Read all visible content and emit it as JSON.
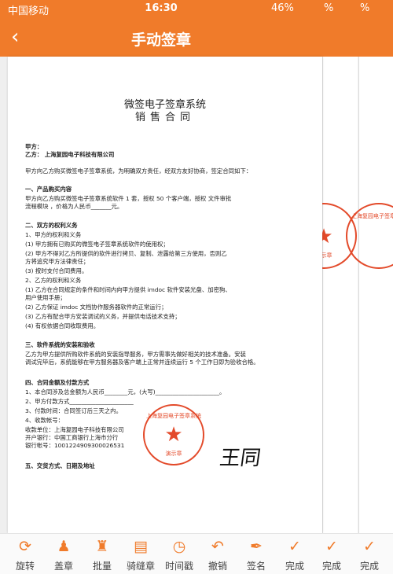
{
  "status": {
    "carrier": "中国移动",
    "time": "16:30",
    "battery": "46%",
    "extra1": "%",
    "extra2": "%"
  },
  "nav": {
    "title": "手动签章"
  },
  "doc": {
    "title": "微签电子签章系统",
    "subtitle": "销售合同",
    "lines": [
      {
        "text": "甲方：",
        "bold": true
      },
      {
        "text": "乙方：   上海复园电子科技有限公司",
        "bold": true
      },
      {
        "text": "     甲方向乙方购买微签电子签章系统，为明确双方责任，经双方友好协商，签定合同如下：",
        "bold": false
      },
      {
        "text": "一、产品购买内容",
        "bold": true
      },
      {
        "text": "     甲方向乙方购买微签电子签章系统软件  1  套，授权  50  个客户端，授权 文件审批",
        "bold": false
      },
      {
        "text": "     流程模块    ，价格为人民币_______元。",
        "bold": false
      },
      {
        "text": "二、双方的权利义务",
        "bold": true
      },
      {
        "text": "     1、甲方的权利和义务",
        "bold": false
      },
      {
        "text": "        (1)    甲方拥有已购买的微签电子签章系统软件的使用权；",
        "bold": false
      },
      {
        "text": "        (2)    甲方不得对乙方所提供的软件进行拷贝、复制、泄露给第三方使用，否则乙",
        "bold": false
      },
      {
        "text": "               方将追究甲方法律责任；",
        "bold": false
      },
      {
        "text": "        (3)    按时支付合同费用。",
        "bold": false
      },
      {
        "text": "     2、乙方的权利和义务",
        "bold": false
      },
      {
        "text": "        (1)    乙方在合同规定的条件和时间内向甲方提供 imdoc 软件安装光盘、加密狗、",
        "bold": false
      },
      {
        "text": "               用户使用手册；",
        "bold": false
      },
      {
        "text": "        (2)    乙方保证 imdoc 文档协作服务器软件的正常运行；",
        "bold": false
      },
      {
        "text": "        (3)    乙方有配合甲方安装调试的义务，并提供电话技术支持；",
        "bold": false
      },
      {
        "text": "        (4)    有权依据合同收取费用。",
        "bold": false
      },
      {
        "text": "三、软件系统的安装和验收",
        "bold": true
      },
      {
        "text": "     乙方为甲方提供所购软件系统的安装指导服务，甲方需事先做好相关的技术准备。安装",
        "bold": false
      },
      {
        "text": "     调试完毕后，系统能够在甲方服务器及客户端上正常并连续运行 5 个工作日即为验收合格。",
        "bold": false
      },
      {
        "text": "四、合同金额及付款方式",
        "bold": true
      },
      {
        "text": "     1、本合同涉及总金额为人民币________元，(大写)______________________。",
        "bold": false
      },
      {
        "text": "     2、甲方付款方式______________________",
        "bold": false
      },
      {
        "text": "     3、付款时间：合同签订后三天之内。",
        "bold": false
      },
      {
        "text": "     4、收款帐号：",
        "bold": false
      },
      {
        "text": "        收款单位：上海复园电子科技有限公司",
        "bold": false
      },
      {
        "text": "        开户银行：中国工商银行上海市分行",
        "bold": false
      },
      {
        "text": "        银行帐号：1001224909300026531",
        "bold": false
      },
      {
        "text": "五、交货方式、日期及地址",
        "bold": true
      }
    ],
    "seal_text": "上海复园电子签章系统",
    "seal_sub": "演示章",
    "signature": "王同"
  },
  "toolbar": [
    {
      "label": "旋转",
      "icon": "rotate-icon",
      "glyph": "⟳"
    },
    {
      "label": "盖章",
      "icon": "stamp-icon",
      "glyph": "♟"
    },
    {
      "label": "批量",
      "icon": "batch-icon",
      "glyph": "♜"
    },
    {
      "label": "骑缝章",
      "icon": "seam-stamp-icon",
      "glyph": "▤"
    },
    {
      "label": "时间戳",
      "icon": "timestamp-icon",
      "glyph": "◷"
    },
    {
      "label": "撤销",
      "icon": "undo-icon",
      "glyph": "↶"
    },
    {
      "label": "签名",
      "icon": "pen-icon",
      "glyph": "✒"
    },
    {
      "label": "完成",
      "icon": "check-icon",
      "glyph": "✓"
    },
    {
      "label": "完成",
      "icon": "check-icon",
      "glyph": "✓"
    },
    {
      "label": "完成",
      "icon": "check-icon",
      "glyph": "✓"
    }
  ],
  "colors": {
    "accent": "#f07b2a",
    "seal": "#e34a2a"
  }
}
